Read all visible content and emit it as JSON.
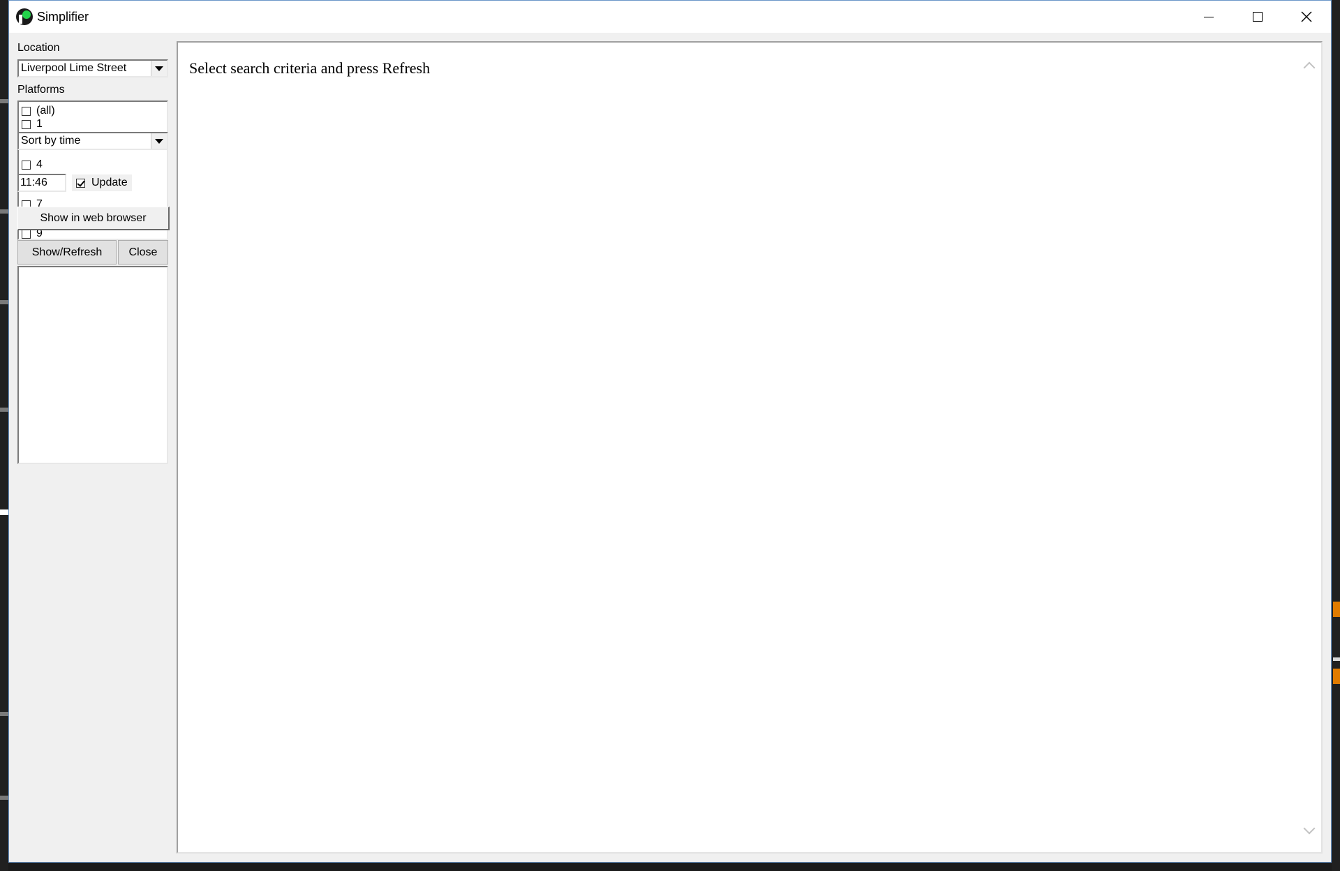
{
  "window": {
    "title": "Simplifier"
  },
  "left_panel": {
    "location_label": "Location",
    "location_value": "Liverpool Lime Street",
    "platforms_label": "Platforms",
    "platforms": [
      {
        "label": "(all)",
        "checked": false
      },
      {
        "label": "1",
        "checked": false
      },
      {
        "label": "4",
        "checked": false
      },
      {
        "label": "7",
        "checked": false
      },
      {
        "label": "9",
        "checked": false
      }
    ],
    "sort_value": "Sort by time",
    "time_value": "11:46",
    "update_label": "Update",
    "update_checked": true,
    "web_button": "Show in web browser",
    "refresh_button": "Show/Refresh",
    "close_button": "Close"
  },
  "main": {
    "message": "Select search criteria and press Refresh"
  },
  "colors": {
    "window_bg": "#f0f0f0",
    "content_bg": "#ffffff",
    "titlebar_bg": "#ffffff",
    "app_icon_accent": "#22d34a"
  }
}
